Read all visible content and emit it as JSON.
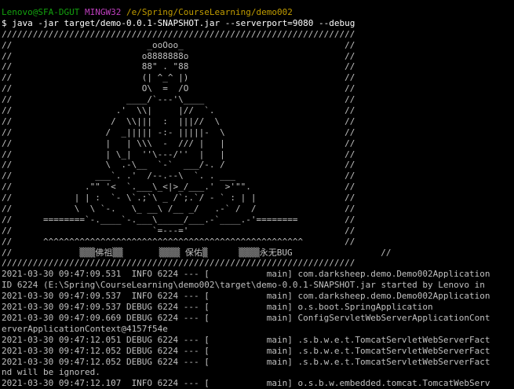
{
  "colors": {
    "background": "#000000",
    "text": "#c0c0c0",
    "prompt_user": "#13a10e",
    "prompt_shell": "#c040c0",
    "prompt_path": "#c19c00",
    "command": "#ffffff"
  },
  "prompt": {
    "user": "Lenovo@SFA-DGUT",
    "shell": "MINGW32",
    "path": "/e/Spring/CourseLearning/demo002"
  },
  "command": "$ java -jar target/demo-0.0.1-SNAPSHOT.jar --serverport=9080 --debug",
  "output_lines": [
    "////////////////////////////////////////////////////////////////////",
    "//                          _ooOoo_                               //",
    "//                         o8888888o                              //",
    "//                         88\" . \"88                              //",
    "//                         (| ^_^ |)                              //",
    "//                         O\\  =  /O                              //",
    "//                      ____/`---'\\____                           //",
    "//                    .'  \\\\|     |//  `.                         //",
    "//                   /  \\\\|||  :  |||//  \\                        //",
    "//                  /  _||||| -:- |||||-  \\                       //",
    "//                  |   | \\\\\\  -  /// |   |                       //",
    "//                  | \\_|  ''\\---/''  |   |                       //",
    "//                  \\  .-\\__  `-`  ___/-. /                       //",
    "//                ___`. .'  /--.--\\  `. . ___                     //",
    "//              .\"\" '<  `.___\\_<|>_/___.'  >'\"\".                  //",
    "//            | | :  `- \\`.;`\\ _ /`;.`/ - ` : | |                 //",
    "//            \\  \\ `-.   \\_ __\\ /__ _/   .-` /  /                 //",
    "//      ========`-.____`-.___\\_____/___.-`____.-'========         //",
    "//                           `=---='                              //",
    "//      ^^^^^^^^^^^^^^^^^^^^^^^^^^^^^^^^^^^^^^^^^^^^^^^^^^        //",
    "//             ▒▒▒佛祖▒▒       ▒▒▒▒ 保佑▒      ▒▒▒▒永无BUG                 //",
    "////////////////////////////////////////////////////////////////////",
    "2021-03-30 09:47:09.531  INFO 6224 --- [           main] com.darksheep.demo.Demo002Application",
    "ID 6224 (E:\\Spring\\CourseLearning\\demo002\\target\\demo-0.0.1-SNAPSHOT.jar started by Lenovo in",
    "2021-03-30 09:47:09.537  INFO 6224 --- [           main] com.darksheep.demo.Demo002Application",
    "2021-03-30 09:47:09.537 DEBUG 6224 --- [           main] o.s.boot.SpringApplication",
    "2021-03-30 09:47:09.669 DEBUG 6224 --- [           main] ConfigServletWebServerApplicationCont",
    "erverApplicationContext@4157f54e",
    "2021-03-30 09:47:12.051 DEBUG 6224 --- [           main] .s.b.w.e.t.TomcatServletWebServerFact",
    "2021-03-30 09:47:12.052 DEBUG 6224 --- [           main] .s.b.w.e.t.TomcatServletWebServerFact",
    "2021-03-30 09:47:12.052 DEBUG 6224 --- [           main] .s.b.w.e.t.TomcatServletWebServerFact",
    "nd will be ignored.",
    "2021-03-30 09:47:12.107  INFO 6224 --- [           main] o.s.b.w.embedded.tomcat.TomcatWebServ"
  ]
}
